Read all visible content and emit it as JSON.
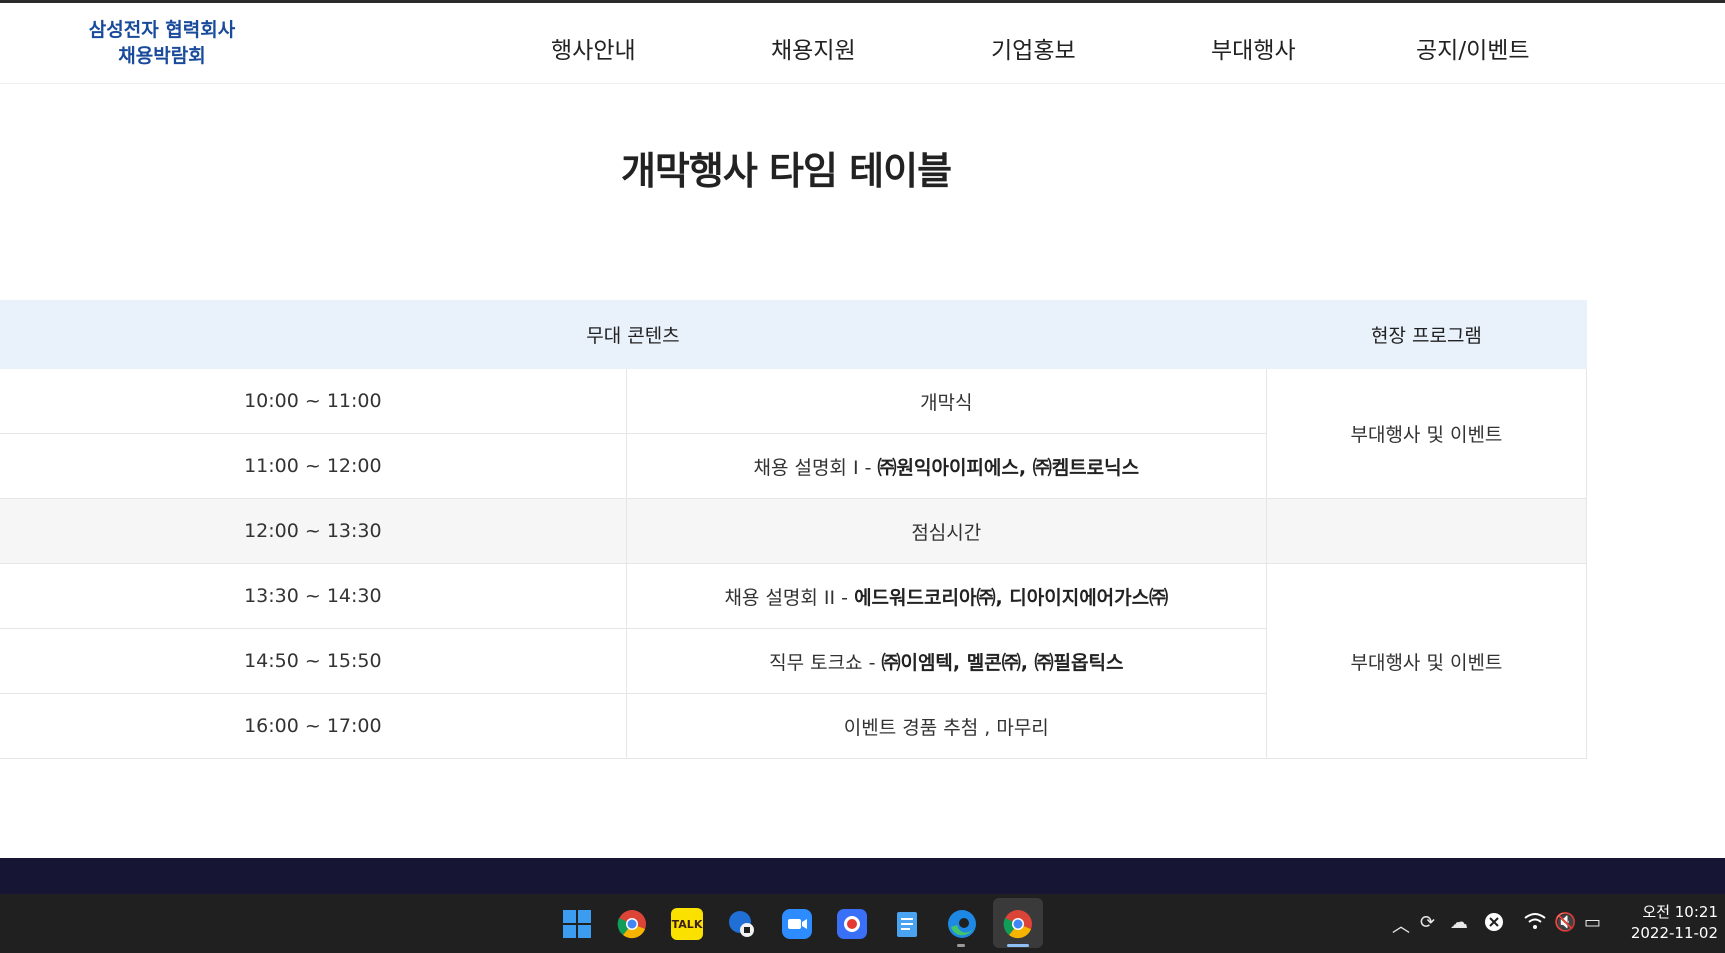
{
  "header": {
    "logo_line1": "삼성전자 협력회사",
    "logo_line2": "채용박람회",
    "nav": [
      "행사안내",
      "채용지원",
      "기업홍보",
      "부대행사",
      "공지/이벤트"
    ]
  },
  "page_title": "개막행사 타임 테이블",
  "table": {
    "head_stage": "무대 콘텐츠",
    "head_program": "현장 프로그램",
    "rows": [
      {
        "time": "10:00 ~ 11:00",
        "content_plain": "개막식",
        "content_bold": ""
      },
      {
        "time": "11:00 ~ 12:00",
        "content_plain": "채용 설명회 I - ",
        "content_bold": "㈜원익아이피에스,  ㈜켐트로닉스"
      },
      {
        "time": "12:00 ~ 13:30",
        "content_plain": "점심시간",
        "content_bold": ""
      },
      {
        "time": "13:30 ~ 14:30",
        "content_plain": "채용 설명회 II - ",
        "content_bold": "에드워드코리아㈜,  디아이지에어가스㈜"
      },
      {
        "time": "14:50 ~ 15:50",
        "content_plain": "직무 토크쇼 - ",
        "content_bold": "㈜이엠텍,  멜콘㈜,  ㈜필옵틱스"
      },
      {
        "time": "16:00 ~ 17:00",
        "content_plain": "이벤트 경품 추첨 , 마무리",
        "content_bold": ""
      }
    ],
    "program_morning": "부대행사 및 이벤트",
    "program_afternoon": "부대행사 및 이벤트"
  },
  "taskbar": {
    "apps": [
      "windows-start",
      "chrome",
      "kakaotalk",
      "messenger",
      "zoom",
      "screen-recorder",
      "notepad",
      "edge",
      "chrome-active"
    ],
    "kakao_label": "TALK",
    "clock_ampm_time": "오전 10:21",
    "clock_date": "2022-11-02"
  },
  "colors": {
    "brand": "#1a4a9b",
    "table_header_bg": "#e9f1fb",
    "footer_bg": "#161534",
    "taskbar_bg": "#202020"
  }
}
